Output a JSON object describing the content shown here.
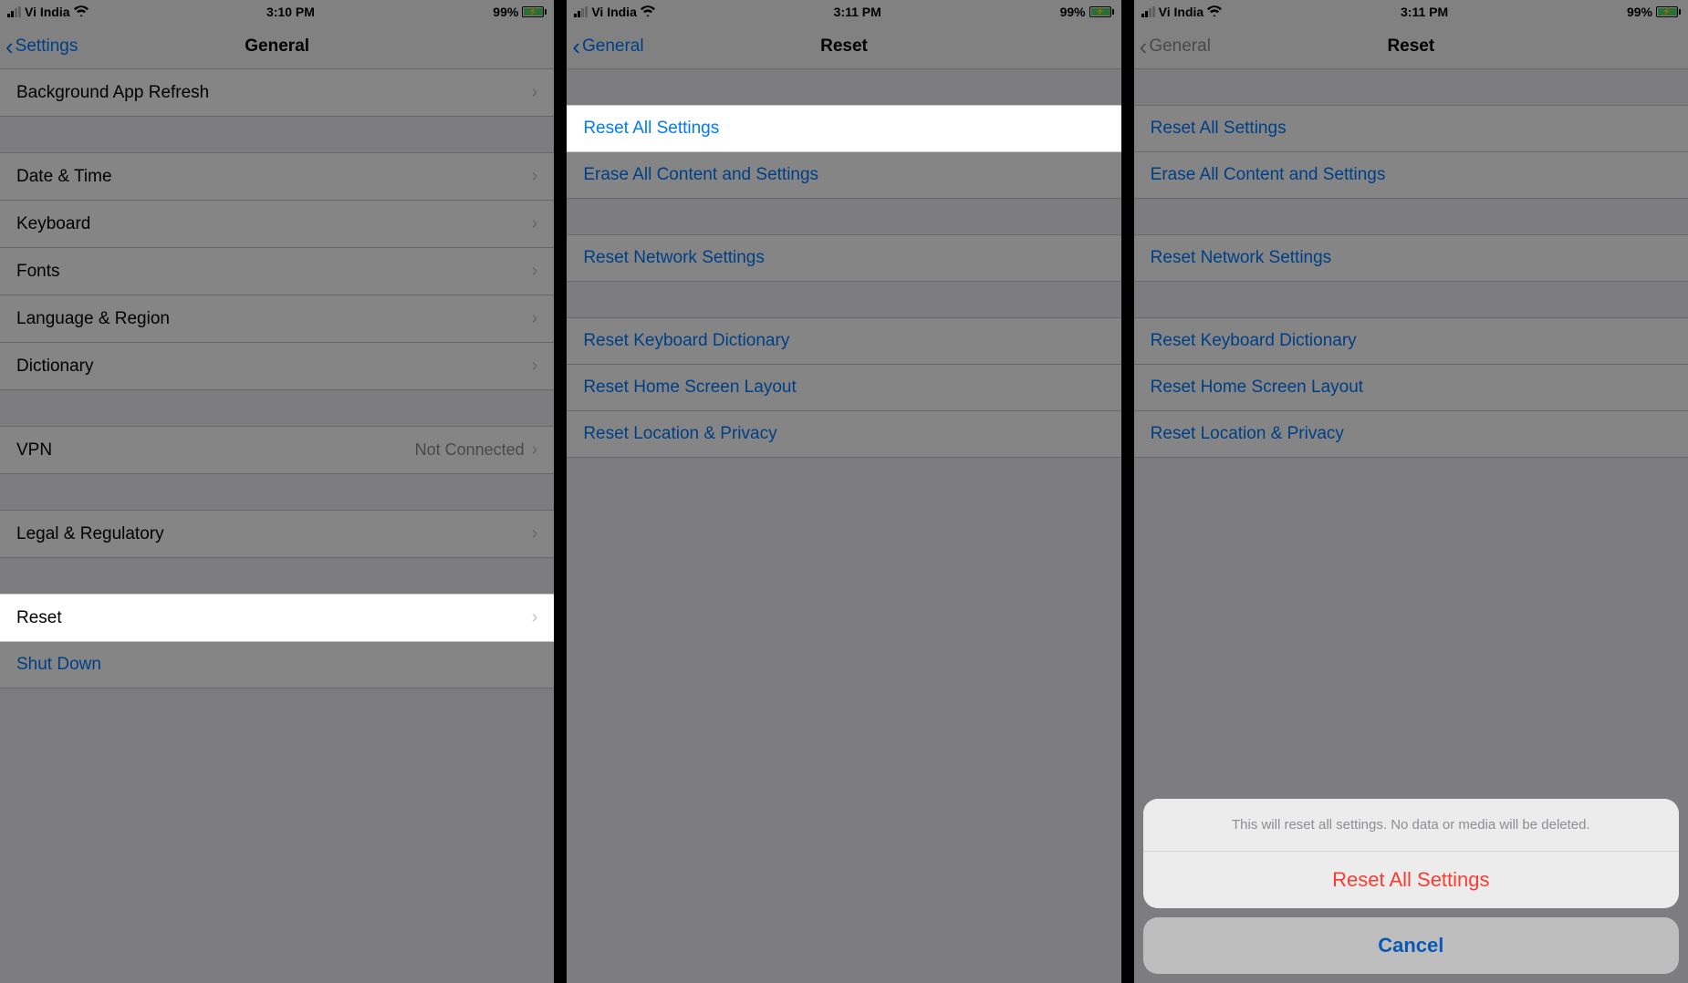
{
  "statusbar": {
    "carrier": "Vi India",
    "battery_pct": "99%"
  },
  "screen1": {
    "time": "3:10 PM",
    "back_label": "Settings",
    "title": "General",
    "rows": {
      "bg_refresh": "Background App Refresh",
      "date_time": "Date & Time",
      "keyboard": "Keyboard",
      "fonts": "Fonts",
      "lang_region": "Language & Region",
      "dictionary": "Dictionary",
      "vpn": "VPN",
      "vpn_detail": "Not Connected",
      "legal": "Legal & Regulatory",
      "reset": "Reset",
      "shutdown": "Shut Down"
    }
  },
  "screen2": {
    "time": "3:11 PM",
    "back_label": "General",
    "title": "Reset",
    "rows": {
      "reset_all": "Reset All Settings",
      "erase_all": "Erase All Content and Settings",
      "reset_network": "Reset Network Settings",
      "reset_keyboard": "Reset Keyboard Dictionary",
      "reset_home": "Reset Home Screen Layout",
      "reset_location": "Reset Location & Privacy"
    }
  },
  "screen3": {
    "time": "3:11 PM",
    "back_label": "General",
    "title": "Reset",
    "rows": {
      "reset_all": "Reset All Settings",
      "erase_all": "Erase All Content and Settings",
      "reset_network": "Reset Network Settings",
      "reset_keyboard": "Reset Keyboard Dictionary",
      "reset_home": "Reset Home Screen Layout",
      "reset_location": "Reset Location & Privacy"
    },
    "sheet": {
      "message": "This will reset all settings. No data or media will be deleted.",
      "action": "Reset All Settings",
      "cancel": "Cancel"
    }
  }
}
